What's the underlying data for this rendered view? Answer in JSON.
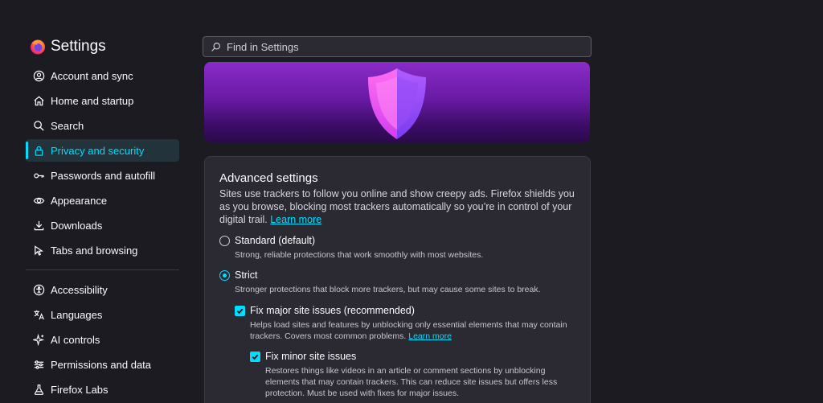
{
  "sidebar": {
    "brand_title": "Settings",
    "items": [
      {
        "label": "Account and sync",
        "icon": "account-icon"
      },
      {
        "label": "Home and startup",
        "icon": "home-icon"
      },
      {
        "label": "Search",
        "icon": "search-icon"
      },
      {
        "label": "Privacy and security",
        "icon": "lock-icon",
        "active": true
      },
      {
        "label": "Passwords and autofill",
        "icon": "key-icon"
      },
      {
        "label": "Appearance",
        "icon": "eye-icon"
      },
      {
        "label": "Downloads",
        "icon": "download-icon"
      },
      {
        "label": "Tabs and browsing",
        "icon": "cursor-icon"
      }
    ],
    "items_secondary": [
      {
        "label": "Accessibility",
        "icon": "accessibility-icon"
      },
      {
        "label": "Languages",
        "icon": "translate-icon"
      },
      {
        "label": "AI controls",
        "icon": "sparkle-icon"
      },
      {
        "label": "Permissions and data",
        "icon": "sliders-icon"
      },
      {
        "label": "Firefox Labs",
        "icon": "flask-icon"
      }
    ]
  },
  "search": {
    "placeholder": "Find in Settings"
  },
  "card": {
    "title": "Advanced settings",
    "description": "Sites use trackers to follow you online and show creepy ads. Firefox shields you as you browse, blocking most trackers automatically so you’re in control of your digital trail.",
    "learn_more": "Learn more",
    "options": {
      "standard": {
        "label": "Standard (default)",
        "desc": "Strong, reliable protections that work smoothly with most websites.",
        "checked": false
      },
      "strict": {
        "label": "Strict",
        "desc": "Stronger protections that block more trackers, but may cause some sites to break.",
        "checked": true
      },
      "fix_major": {
        "label": "Fix major site issues (recommended)",
        "desc": "Helps load sites and features by unblocking only essential elements that may contain trackers. Covers most common problems.",
        "learn_more": "Learn more",
        "checked": true
      },
      "fix_minor": {
        "label": "Fix minor site issues",
        "desc": "Restores things like videos in an article or comment sections by unblocking elements that may contain trackers. This can reduce site issues but offers less protection. Must be used with fixes for major issues.",
        "checked": true
      }
    }
  },
  "colors": {
    "background": "#1c1b22",
    "accent": "#00ddff",
    "card": "#2b2a33"
  }
}
